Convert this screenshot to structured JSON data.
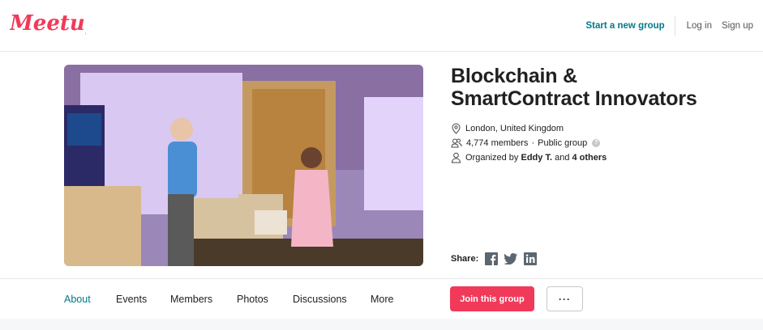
{
  "header": {
    "logo_text": "Meetup",
    "start_group": "Start a new group",
    "login": "Log in",
    "signup": "Sign up"
  },
  "group": {
    "title_line1": "Blockchain &",
    "title_line2": "SmartContract Innovators",
    "location": "London, United Kingdom",
    "members": "4,774 members",
    "separator": "·",
    "privacy": "Public group",
    "help_glyph": "?",
    "organized_prefix": "Organized by",
    "organizer": "Eddy T.",
    "organized_and": "and",
    "others": "4 others"
  },
  "share": {
    "label": "Share:",
    "icons": [
      "facebook-icon",
      "twitter-icon",
      "linkedin-icon"
    ]
  },
  "tabs": [
    {
      "label": "About",
      "active": true
    },
    {
      "label": "Events",
      "active": false
    },
    {
      "label": "Members",
      "active": false
    },
    {
      "label": "Photos",
      "active": false
    },
    {
      "label": "Discussions",
      "active": false
    },
    {
      "label": "More",
      "active": false
    }
  ],
  "actions": {
    "join": "Join this group",
    "more": "···"
  },
  "colors": {
    "brand": "#f13a59",
    "accent": "#00798a"
  }
}
